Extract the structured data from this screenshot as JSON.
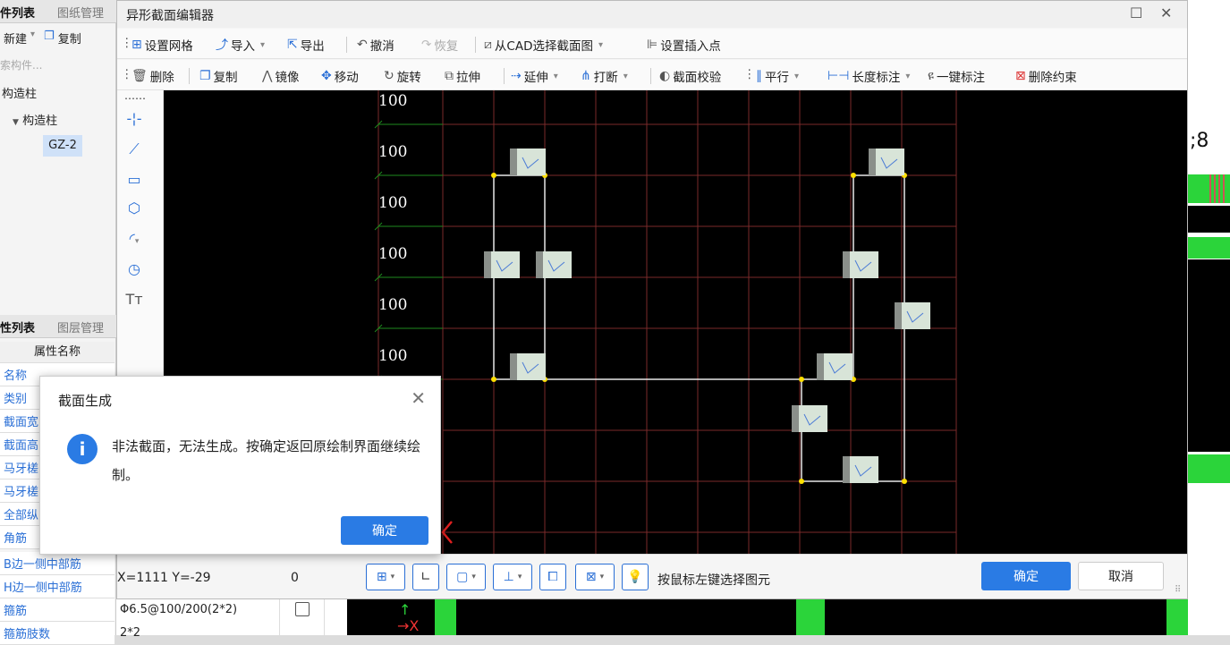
{
  "left_panel": {
    "tab1_active": "件列表",
    "tab1_inactive": "图纸管理",
    "new_label": "新建",
    "copy_label": "复制",
    "search_placeholder": "索构件...",
    "tree_root": "构造柱",
    "tree_child": "构造柱",
    "tree_leaf": "GZ-2",
    "tab2_active": "性列表",
    "tab2_inactive": "图层管理",
    "table_header": "属性名称",
    "rows": [
      "名称",
      "类别",
      "截面宽",
      "截面高",
      "马牙槎",
      "马牙槎",
      "全部纵",
      "角筋",
      "B边一侧中部筋",
      "H边一侧中部筋",
      "箍筋",
      "箍筋肢数"
    ],
    "stirrup_value": "Φ6.5@100/200(2*2)",
    "legs_value": "2*2"
  },
  "window": {
    "title": "异形截面编辑器",
    "toolbar1": {
      "grid": "设置网格",
      "import": "导入",
      "export": "导出",
      "undo": "撤消",
      "redo": "恢复",
      "cad_select": "从CAD选择截面图",
      "insert_point": "设置插入点"
    },
    "toolbar2": {
      "delete": "删除",
      "copy": "复制",
      "mirror": "镜像",
      "move": "移动",
      "rotate": "旋转",
      "stretch": "拉伸",
      "extend": "延伸",
      "break": "打断",
      "check": "截面校验",
      "parallel": "平行",
      "length_dim": "长度标注",
      "auto_dim": "一键标注",
      "del_constraint": "删除约束"
    },
    "grid_labels": [
      "100",
      "100",
      "100",
      "100",
      "100",
      "100"
    ],
    "status": {
      "coords": "X=1111 Y=-29",
      "value": "0",
      "hint": "按鼠标左键选择图元",
      "ok": "确定",
      "cancel": "取消"
    }
  },
  "right_label": ";8",
  "dialog": {
    "title": "截面生成",
    "message": "非法截面，无法生成。按确定返回原绘制界面继续绘制。",
    "ok": "确定"
  },
  "colors": {
    "accent": "#2a7be4",
    "canvas_bg": "#000000",
    "grid_red": "#7a2a2a",
    "grid_green": "#1e8a1e"
  }
}
